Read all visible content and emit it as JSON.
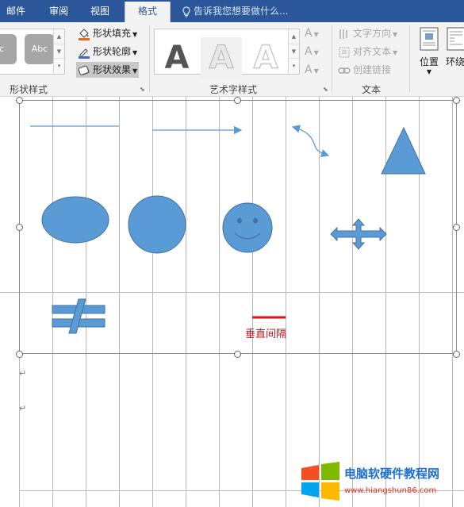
{
  "tabs": [
    {
      "label": "邮件"
    },
    {
      "label": "审阅"
    },
    {
      "label": "视图"
    },
    {
      "label": "格式",
      "active": true
    }
  ],
  "tell_me": {
    "placeholder": "告诉我您想要做什么..."
  },
  "shape_styles": {
    "gallery_items": [
      "c",
      "Abc"
    ],
    "commands": [
      {
        "label": "形状填充",
        "icon": "paint-bucket-icon"
      },
      {
        "label": "形状轮廓",
        "icon": "pen-outline-icon"
      },
      {
        "label": "形状效果",
        "icon": "shape-effects-icon",
        "active": true
      }
    ],
    "group_label": "形状样式"
  },
  "wordart_styles": {
    "letters": [
      "A",
      "A",
      "A"
    ],
    "side_letters": [
      "A",
      "A",
      "A"
    ],
    "group_label": "艺术字样式"
  },
  "text_group": {
    "commands": [
      {
        "label": "文字方向",
        "icon": "text-direction-icon"
      },
      {
        "label": "对齐文本",
        "icon": "align-text-icon"
      },
      {
        "label": "创建链接",
        "icon": "link-icon"
      }
    ],
    "group_label": "文本"
  },
  "position_button": {
    "label": "位置"
  },
  "wrap_button": {
    "label": "环绕"
  },
  "canvas": {
    "annotation_label": "垂直间隔"
  },
  "watermark": {
    "text": "电脑软硬件教程网",
    "url": "www.hiangshun86.com"
  },
  "colors": {
    "ribbon_blue": "#2b579a",
    "shape_fill": "#5b9bd5",
    "shape_stroke": "#41719c",
    "annotation_red": "#c0161e"
  }
}
